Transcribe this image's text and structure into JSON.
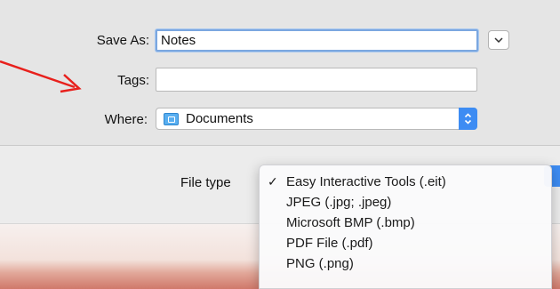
{
  "dialog": {
    "save_as_label": "Save As:",
    "save_as_value": "Notes",
    "tags_label": "Tags:",
    "tags_value": "",
    "where_label": "Where:",
    "where_value": "Documents"
  },
  "file_type": {
    "label": "File type",
    "options": [
      {
        "label": "Easy Interactive Tools (.eit)",
        "checked": true
      },
      {
        "label": "JPEG (.jpg; .jpeg)",
        "checked": false
      },
      {
        "label": "Microsoft BMP (.bmp)",
        "checked": false
      },
      {
        "label": "PDF File (.pdf)",
        "checked": false
      },
      {
        "label": "PNG (.png)",
        "checked": false
      }
    ],
    "check_glyph": "✓"
  },
  "icons": {
    "expand": "chevron-down-icon",
    "where_folder": "folder-icon",
    "where_stepper": "up-down-chevron-icon",
    "annotation": "red-arrow-icon"
  },
  "colors": {
    "accent_blue": "#3d8cf3",
    "focus_ring": "#7ba7e0",
    "annotation_red": "#e8201c",
    "folder_blue": "#58aef0"
  }
}
